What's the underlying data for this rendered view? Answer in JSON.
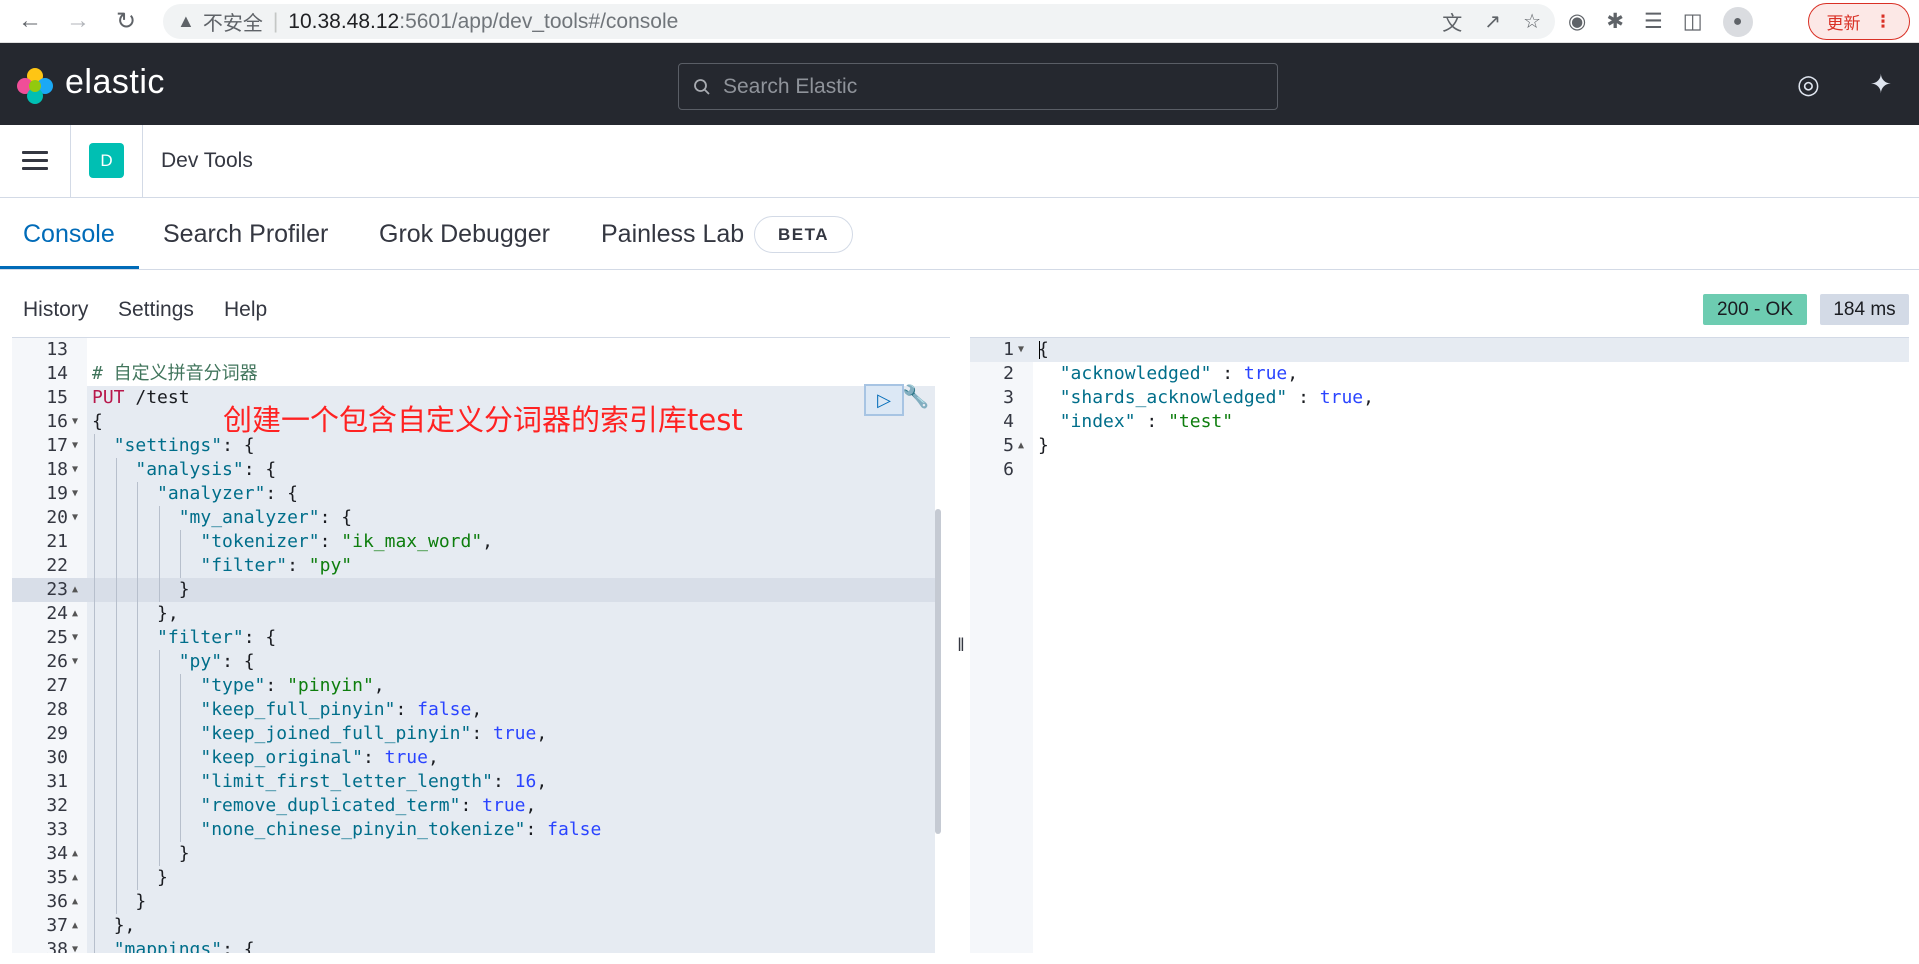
{
  "browser": {
    "insecure_label": "不安全",
    "url_host": "10.38.48.12",
    "url_rest": ":5601/app/dev_tools#/console",
    "update_label": "更新"
  },
  "header": {
    "brand": "elastic",
    "search_placeholder": "Search Elastic"
  },
  "breadcrumb": {
    "space_initial": "D",
    "title": "Dev Tools"
  },
  "tabs": [
    {
      "label": "Console",
      "active": true
    },
    {
      "label": "Search Profiler"
    },
    {
      "label": "Grok Debugger"
    },
    {
      "label": "Painless Lab"
    }
  ],
  "beta_label": "BETA",
  "toolbar": {
    "history": "History",
    "settings": "Settings",
    "help": "Help",
    "status": "200 - OK",
    "duration": "184 ms"
  },
  "annotation": "创建一个包含自定义分词器的索引库test",
  "request_lines": [
    {
      "n": "13",
      "fold": "",
      "guides": 0,
      "html": ""
    },
    {
      "n": "14",
      "fold": "",
      "guides": 0,
      "html": "<span class=\"c\"># 自定义拼音分词器</span>"
    },
    {
      "n": "15",
      "fold": "",
      "guides": 0,
      "html": "<span class=\"m\">PUT</span> <span class=\"p\">/test</span>"
    },
    {
      "n": "16",
      "fold": "down",
      "guides": 0,
      "html": "<span class=\"p\">{</span>"
    },
    {
      "n": "17",
      "fold": "down",
      "guides": 1,
      "html": "  <span class=\"k\">\"settings\"</span><span class=\"p\">: {</span>"
    },
    {
      "n": "18",
      "fold": "down",
      "guides": 2,
      "html": "    <span class=\"k\">\"analysis\"</span><span class=\"p\">: {</span>"
    },
    {
      "n": "19",
      "fold": "down",
      "guides": 3,
      "html": "      <span class=\"k\">\"analyzer\"</span><span class=\"p\">: {</span>"
    },
    {
      "n": "20",
      "fold": "down",
      "guides": 4,
      "html": "        <span class=\"k\">\"my_analyzer\"</span><span class=\"p\">: {</span>"
    },
    {
      "n": "21",
      "fold": "",
      "guides": 5,
      "html": "          <span class=\"k\">\"tokenizer\"</span><span class=\"p\">: </span><span class=\"s\">\"ik_max_word\"</span><span class=\"p\">,</span>"
    },
    {
      "n": "22",
      "fold": "",
      "guides": 5,
      "html": "          <span class=\"k\">\"filter\"</span><span class=\"p\">: </span><span class=\"s\">\"py\"</span>"
    },
    {
      "n": "23",
      "fold": "up",
      "guides": 4,
      "html": "        <span class=\"p\">}</span>"
    },
    {
      "n": "24",
      "fold": "up",
      "guides": 3,
      "html": "      <span class=\"p\">},</span>"
    },
    {
      "n": "25",
      "fold": "down",
      "guides": 3,
      "html": "      <span class=\"k\">\"filter\"</span><span class=\"p\">: {</span>"
    },
    {
      "n": "26",
      "fold": "down",
      "guides": 4,
      "html": "        <span class=\"k\">\"py\"</span><span class=\"p\">: {</span>"
    },
    {
      "n": "27",
      "fold": "",
      "guides": 5,
      "html": "          <span class=\"k\">\"type\"</span><span class=\"p\">: </span><span class=\"s\">\"pinyin\"</span><span class=\"p\">,</span>"
    },
    {
      "n": "28",
      "fold": "",
      "guides": 5,
      "html": "          <span class=\"k\">\"keep_full_pinyin\"</span><span class=\"p\">: </span><span class=\"b\">false</span><span class=\"p\">,</span>"
    },
    {
      "n": "29",
      "fold": "",
      "guides": 5,
      "html": "          <span class=\"k\">\"keep_joined_full_pinyin\"</span><span class=\"p\">: </span><span class=\"b\">true</span><span class=\"p\">,</span>"
    },
    {
      "n": "30",
      "fold": "",
      "guides": 5,
      "html": "          <span class=\"k\">\"keep_original\"</span><span class=\"p\">: </span><span class=\"b\">true</span><span class=\"p\">,</span>"
    },
    {
      "n": "31",
      "fold": "",
      "guides": 5,
      "html": "          <span class=\"k\">\"limit_first_letter_length\"</span><span class=\"p\">: </span><span class=\"n\">16</span><span class=\"p\">,</span>"
    },
    {
      "n": "32",
      "fold": "",
      "guides": 5,
      "html": "          <span class=\"k\">\"remove_duplicated_term\"</span><span class=\"p\">: </span><span class=\"b\">true</span><span class=\"p\">,</span>"
    },
    {
      "n": "33",
      "fold": "",
      "guides": 5,
      "html": "          <span class=\"k\">\"none_chinese_pinyin_tokenize\"</span><span class=\"p\">: </span><span class=\"b\">false</span>"
    },
    {
      "n": "34",
      "fold": "up",
      "guides": 4,
      "html": "        <span class=\"p\">}</span>"
    },
    {
      "n": "35",
      "fold": "up",
      "guides": 3,
      "html": "      <span class=\"p\">}</span>"
    },
    {
      "n": "36",
      "fold": "up",
      "guides": 2,
      "html": "    <span class=\"p\">}</span>"
    },
    {
      "n": "37",
      "fold": "up",
      "guides": 1,
      "html": "  <span class=\"p\">},</span>"
    },
    {
      "n": "38",
      "fold": "down",
      "guides": 1,
      "html": "  <span class=\"k\">\"mappings\"</span><span class=\"p\">: {</span>"
    }
  ],
  "response_lines": [
    {
      "n": "1",
      "fold": "down",
      "html": "<span class=\"p\">{</span>"
    },
    {
      "n": "2",
      "fold": "",
      "html": "  <span class=\"k\">\"acknowledged\"</span><span class=\"p\"> : </span><span class=\"b\">true</span><span class=\"p\">,</span>"
    },
    {
      "n": "3",
      "fold": "",
      "html": "  <span class=\"k\">\"shards_acknowledged\"</span><span class=\"p\"> : </span><span class=\"b\">true</span><span class=\"p\">,</span>"
    },
    {
      "n": "4",
      "fold": "",
      "html": "  <span class=\"k\">\"index\"</span><span class=\"p\"> : </span><span class=\"s\">\"test\"</span>"
    },
    {
      "n": "5",
      "fold": "up",
      "html": "<span class=\"p\">}</span>"
    },
    {
      "n": "6",
      "fold": "",
      "html": ""
    }
  ]
}
